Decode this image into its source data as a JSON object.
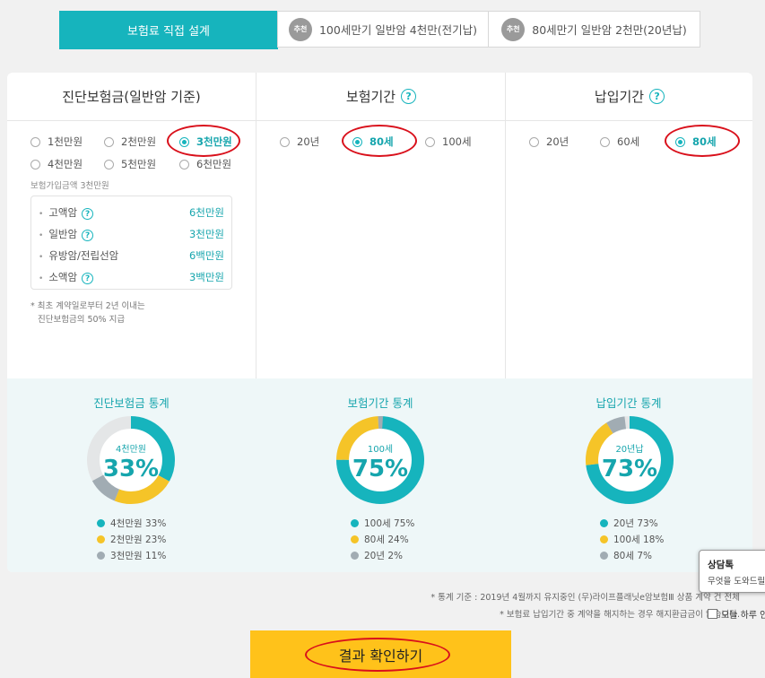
{
  "tabs": [
    {
      "label": "보험료 직접 설계",
      "active": true
    },
    {
      "badge": "추천",
      "label": "100세만기 일반암 4천만(전기납)"
    },
    {
      "badge": "추천",
      "label": "80세만기 일반암 2천만(20년납)"
    }
  ],
  "columns": {
    "amount": {
      "title": "진단보험금(일반암 기준)",
      "options": [
        "1천만원",
        "2천만원",
        "3천만원",
        "4천만원",
        "5천만원",
        "6천만원"
      ],
      "selected": "3천만원",
      "sub_note": "보험가입금액 3천만원",
      "breakdown": [
        {
          "label": "고액암",
          "value": "6천만원",
          "help": true
        },
        {
          "label": "일반암",
          "value": "3천만원",
          "help": true
        },
        {
          "label": "유방암/전립선암",
          "value": "6백만원",
          "help": false
        },
        {
          "label": "소액암",
          "value": "3백만원",
          "help": true
        }
      ],
      "footnote_1": "* 최초 계약일로부터 2년 이내는",
      "footnote_2": "진단보험금의 50% 지급"
    },
    "term": {
      "title": "보험기간",
      "options": [
        "20년",
        "80세",
        "100세"
      ],
      "selected": "80세"
    },
    "pay": {
      "title": "납입기간",
      "options": [
        "20년",
        "60세",
        "80세"
      ],
      "selected": "80세"
    }
  },
  "help_glyph": "?",
  "stats": [
    {
      "title": "진단보험금 통계",
      "center_label": "4천만원",
      "center_pct": "33%",
      "segments": [
        {
          "label": "4천만원 33%",
          "value": 33,
          "color": "#16b4bd"
        },
        {
          "label": "2천만원 23%",
          "value": 23,
          "color": "#f5c428"
        },
        {
          "label": "3천만원 11%",
          "value": 11,
          "color": "#a1acb3"
        }
      ]
    },
    {
      "title": "보험기간 통계",
      "center_label": "100세",
      "center_pct": "75%",
      "segments": [
        {
          "label": "100세 75%",
          "value": 75,
          "color": "#16b4bd"
        },
        {
          "label": "80세 24%",
          "value": 24,
          "color": "#f5c428"
        },
        {
          "label": "20년 2%",
          "value": 2,
          "color": "#a1acb3"
        }
      ]
    },
    {
      "title": "납입기간 통계",
      "center_label": "20년납",
      "center_pct": "73%",
      "segments": [
        {
          "label": "20년 73%",
          "value": 73,
          "color": "#16b4bd"
        },
        {
          "label": "100세 18%",
          "value": 18,
          "color": "#f5c428"
        },
        {
          "label": "80세 7%",
          "value": 7,
          "color": "#a1acb3"
        }
      ]
    }
  ],
  "notes": {
    "line1": "* 통계 기준 : 2019년 4월까지 유지중인 (무)라이프플래닛e암보험Ⅲ 상품 계약 건 전체",
    "line2": "* 보험료 납입기간 중 계약을 해지하는 경우 해지환급금이 없습니다."
  },
  "result_button": "결과 확인하기",
  "chat": {
    "title": "상담톡",
    "subtitle": "무엇을 도와드릴까요?",
    "today_label": "오늘 하루 안보기"
  }
}
